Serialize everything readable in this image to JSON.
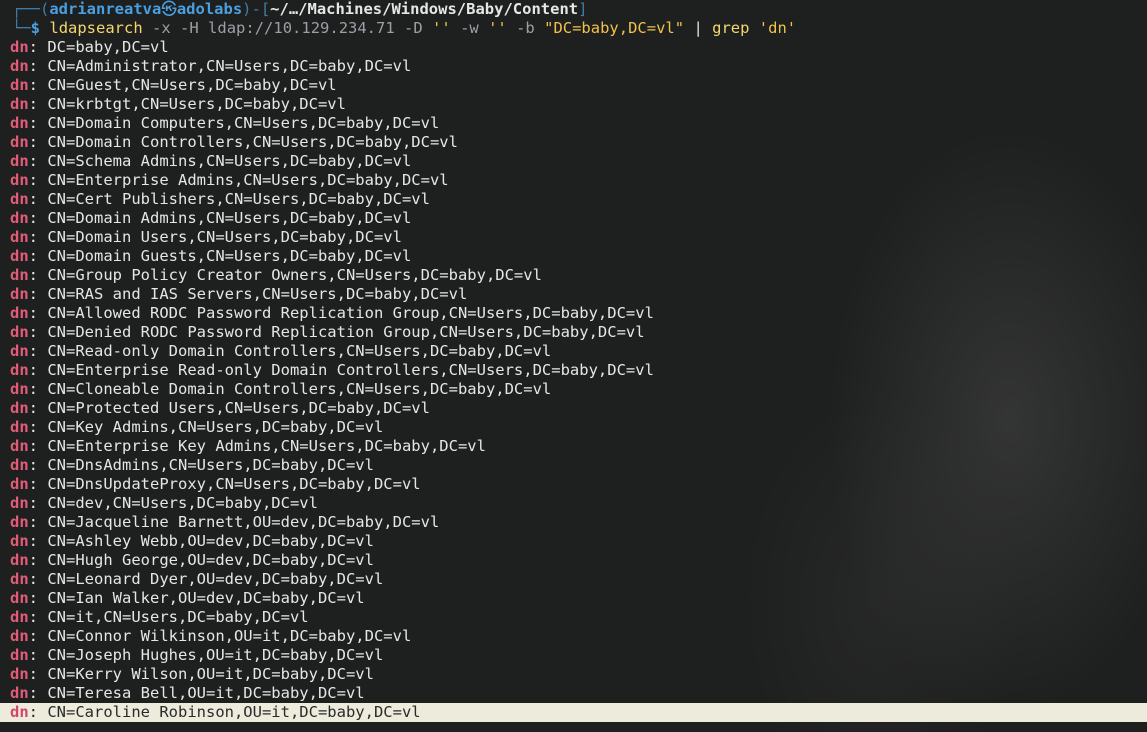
{
  "prompt": {
    "frame_top": "┌──(",
    "user": "adrianreatva",
    "at_symbol": "㉿",
    "host": "adolabs",
    "frame_mid": ")-[",
    "path": "~/…/Machines/Windows/Baby/Content",
    "frame_end": "]",
    "frame_bottom": "└─",
    "dollar": "$"
  },
  "command": {
    "program": "ldapsearch",
    "args1": "-x -H",
    "url": "ldap://10.129.234.71",
    "args2": "-D",
    "empty1": "''",
    "args3": "-w",
    "empty2": "''",
    "args4": "-b",
    "base": "\"DC=baby,DC=vl\"",
    "pipe": "|",
    "grep": "grep",
    "pattern": "'dn'"
  },
  "output": {
    "key": "dn",
    "lines": [
      "DC=baby,DC=vl",
      "CN=Administrator,CN=Users,DC=baby,DC=vl",
      "CN=Guest,CN=Users,DC=baby,DC=vl",
      "CN=krbtgt,CN=Users,DC=baby,DC=vl",
      "CN=Domain Computers,CN=Users,DC=baby,DC=vl",
      "CN=Domain Controllers,CN=Users,DC=baby,DC=vl",
      "CN=Schema Admins,CN=Users,DC=baby,DC=vl",
      "CN=Enterprise Admins,CN=Users,DC=baby,DC=vl",
      "CN=Cert Publishers,CN=Users,DC=baby,DC=vl",
      "CN=Domain Admins,CN=Users,DC=baby,DC=vl",
      "CN=Domain Users,CN=Users,DC=baby,DC=vl",
      "CN=Domain Guests,CN=Users,DC=baby,DC=vl",
      "CN=Group Policy Creator Owners,CN=Users,DC=baby,DC=vl",
      "CN=RAS and IAS Servers,CN=Users,DC=baby,DC=vl",
      "CN=Allowed RODC Password Replication Group,CN=Users,DC=baby,DC=vl",
      "CN=Denied RODC Password Replication Group,CN=Users,DC=baby,DC=vl",
      "CN=Read-only Domain Controllers,CN=Users,DC=baby,DC=vl",
      "CN=Enterprise Read-only Domain Controllers,CN=Users,DC=baby,DC=vl",
      "CN=Cloneable Domain Controllers,CN=Users,DC=baby,DC=vl",
      "CN=Protected Users,CN=Users,DC=baby,DC=vl",
      "CN=Key Admins,CN=Users,DC=baby,DC=vl",
      "CN=Enterprise Key Admins,CN=Users,DC=baby,DC=vl",
      "CN=DnsAdmins,CN=Users,DC=baby,DC=vl",
      "CN=DnsUpdateProxy,CN=Users,DC=baby,DC=vl",
      "CN=dev,CN=Users,DC=baby,DC=vl",
      "CN=Jacqueline Barnett,OU=dev,DC=baby,DC=vl",
      "CN=Ashley Webb,OU=dev,DC=baby,DC=vl",
      "CN=Hugh George,OU=dev,DC=baby,DC=vl",
      "CN=Leonard Dyer,OU=dev,DC=baby,DC=vl",
      "CN=Ian Walker,OU=dev,DC=baby,DC=vl",
      "CN=it,CN=Users,DC=baby,DC=vl",
      "CN=Connor Wilkinson,OU=it,DC=baby,DC=vl",
      "CN=Joseph Hughes,OU=it,DC=baby,DC=vl",
      "CN=Kerry Wilson,OU=it,DC=baby,DC=vl",
      "CN=Teresa Bell,OU=it,DC=baby,DC=vl",
      "CN=Caroline Robinson,OU=it,DC=baby,DC=vl"
    ]
  },
  "colors": {
    "background": "#1e1f1f",
    "dn_key": "#e05c78",
    "prompt_user": "#4a9fe0",
    "command": "#f5d76e",
    "highlight_bg": "#ecebdc"
  }
}
